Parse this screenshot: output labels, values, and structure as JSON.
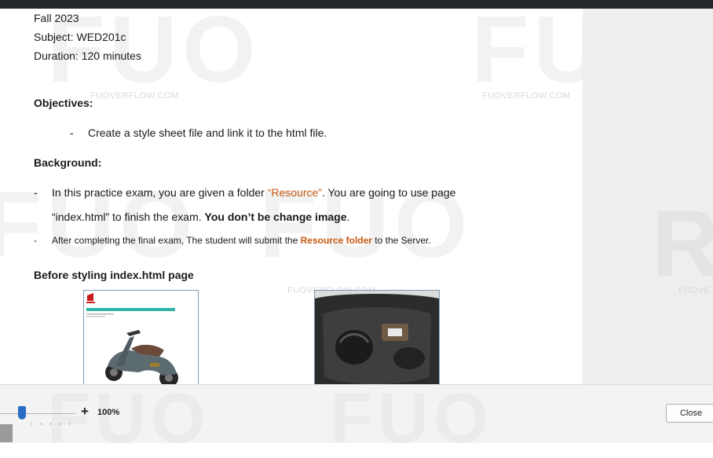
{
  "document": {
    "term": "Fall 2023",
    "subject": "Subject: WED201c",
    "duration": "Duration: 120 minutes",
    "objectives_heading": "Objectives:",
    "objective_dash": "-",
    "objective_item": "Create a style sheet file and link it to the html file.",
    "background_heading": "Background:",
    "bullet1_dash": "-",
    "bullet1_part1": "In this practice exam, you are given a folder ",
    "bullet1_highlight": "“Resource”",
    "bullet1_part2": ". You are going to use page",
    "bullet1_line2_part1": "“index.html”  to finish the exam. ",
    "bullet1_line2_bold": "You don’t be change image",
    "bullet1_line2_end": ".",
    "bullet2_dash": "-",
    "bullet2_part1": "After completing the final exam, The student will submit the ",
    "bullet2_highlight": "Resource folder",
    "bullet2_part2": " to the Server.",
    "before_heading": "Before styling index.html page"
  },
  "watermark": {
    "text": "FUOVERFLOW.COM",
    "text_right": "FUOVE",
    "letters": "FUO",
    "letters_right": "R"
  },
  "footer": {
    "zoom_plus": "+",
    "zoom_level": "100%",
    "close_label": "Close"
  },
  "colors": {
    "highlight": "#c55a11",
    "topbar": "#23262b",
    "slider_thumb": "#2b6cc4"
  }
}
